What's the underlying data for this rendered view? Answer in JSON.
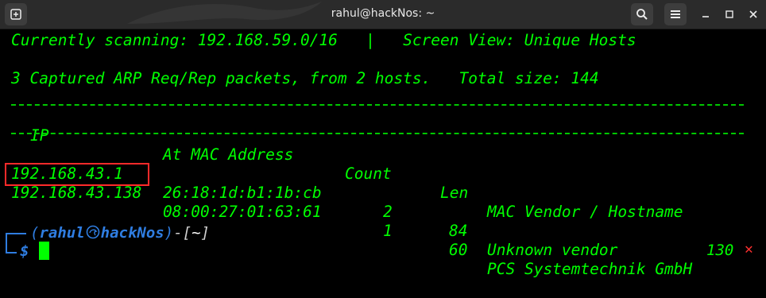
{
  "window": {
    "title": "rahul@hackNos: ~"
  },
  "scan": {
    "status_line": "Currently scanning: 192.168.59.0/16   |   Screen View: Unique Hosts",
    "summary_line": "3 Captured ARP Req/Rep packets, from 2 hosts.   Total size: 144"
  },
  "table": {
    "headers": {
      "ip": "IP",
      "mac": "At MAC Address",
      "count": "Count",
      "len": "Len",
      "vendor": "MAC Vendor / Hostname"
    },
    "rows": [
      {
        "ip": "192.168.43.1",
        "mac": "26:18:1d:b1:1b:cb",
        "count": "2",
        "len": "84",
        "vendor": "Unknown vendor"
      },
      {
        "ip": "192.168.43.138",
        "mac": "08:00:27:01:63:61",
        "count": "1",
        "len": "60",
        "vendor": "PCS Systemtechnik GmbH"
      }
    ]
  },
  "prompt": {
    "user": "rahul",
    "host": "hackNos",
    "path": "~",
    "symbol": "$",
    "exit_code": "130"
  },
  "colors": {
    "terminal_text": "#00ff00",
    "prompt_blue": "#2f7de1",
    "highlight_red": "#ff2a2a",
    "titlebar": "#2b2b2b"
  },
  "icons": [
    "new-tab-icon",
    "search-icon",
    "hamburger-menu-icon",
    "minimize-icon",
    "maximize-icon",
    "close-icon",
    "kali-skull-icon",
    "error-x-icon"
  ]
}
